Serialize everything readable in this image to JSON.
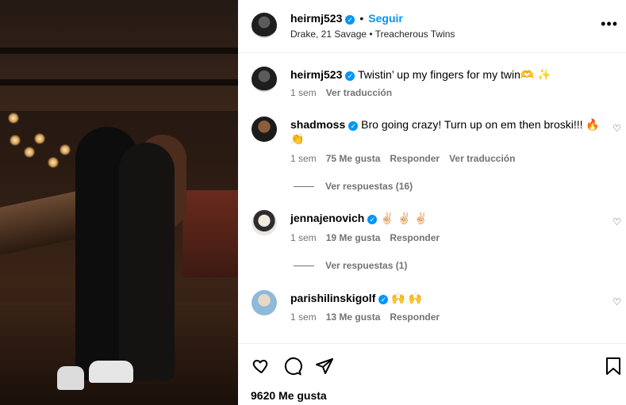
{
  "post": {
    "author": "heirmj523",
    "follow_label": "Seguir",
    "audio": "Drake, 21 Savage • Treacherous Twins",
    "more_label": "•••"
  },
  "caption": {
    "username": "heirmj523",
    "text": "Twistin’ up my fingers for my twin🫶 ✨",
    "time": "1 sem",
    "translate": "Ver traducción"
  },
  "comments": [
    {
      "username": "shadmoss",
      "text": "Bro going crazy! Turn up on em then broski!!! 🔥 👏",
      "time": "1 sem",
      "likes": "75 Me gusta",
      "reply": "Responder",
      "translate": "Ver traducción",
      "view_replies": "Ver respuestas (16)"
    },
    {
      "username": "jennajenovich",
      "text": "✌🏻 ✌🏻 ✌🏻",
      "time": "1 sem",
      "likes": "19 Me gusta",
      "reply": "Responder",
      "view_replies": "Ver respuestas (1)"
    },
    {
      "username": "parishilinskigolf",
      "text": "🙌 🙌",
      "time": "1 sem",
      "likes": "13 Me gusta",
      "reply": "Responder"
    }
  ],
  "footer": {
    "likes": "9620 Me gusta"
  },
  "icons": {
    "heart": "♡",
    "comment": "◯",
    "share": "➤",
    "bookmark": "🔖"
  },
  "colors": {
    "accent": "#0095f6",
    "muted": "#737373"
  }
}
